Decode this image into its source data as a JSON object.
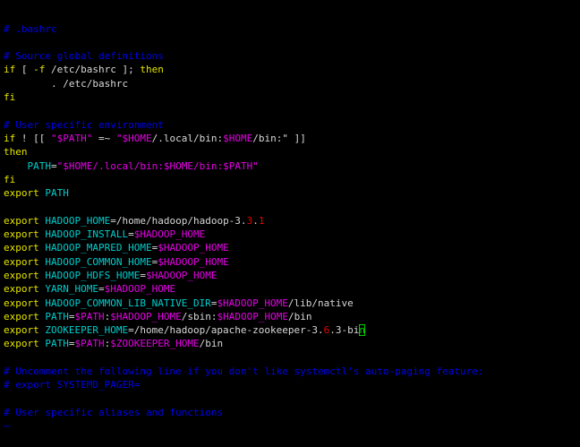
{
  "theme": {
    "background": "#000000",
    "comment": "#0000ee",
    "keyword": "#e5e500",
    "text": "#d8d8d8",
    "variable": "#e500e5",
    "number": "#e50000",
    "identifier": "#00cdcd",
    "cursor": "#00cd00"
  },
  "editor": {
    "lines": [
      [
        [
          "c-comment",
          "# .bashrc"
        ]
      ],
      [],
      [
        [
          "c-comment",
          "# Source global definitions"
        ]
      ],
      [
        [
          "c-kw",
          "if"
        ],
        [
          "c-plain",
          " [ "
        ],
        [
          "c-kw",
          "-f"
        ],
        [
          "c-plain",
          " /etc/bashrc ]; "
        ],
        [
          "c-kw",
          "then"
        ]
      ],
      [
        [
          "c-plain",
          "        . /etc/bashrc"
        ]
      ],
      [
        [
          "c-kw",
          "fi"
        ]
      ],
      [],
      [
        [
          "c-comment",
          "# User specific environment"
        ]
      ],
      [
        [
          "c-kw",
          "if"
        ],
        [
          "c-plain",
          " ! [[ "
        ],
        [
          "c-var",
          "\"$PATH\""
        ],
        [
          "c-plain",
          " =~ "
        ],
        [
          "c-var",
          "\"$HOME"
        ],
        [
          "c-plain",
          "/.local/bin:"
        ],
        [
          "c-var",
          "$HOME"
        ],
        [
          "c-plain",
          "/bin:\""
        ],
        [
          "c-plain",
          " ]]"
        ]
      ],
      [
        [
          "c-kw",
          "then"
        ]
      ],
      [
        [
          "c-plain",
          "    "
        ],
        [
          "c-ident",
          "PATH"
        ],
        [
          "c-plain",
          "="
        ],
        [
          "c-var",
          "\"$HOME"
        ],
        [
          "c-var",
          "/.local/bin:"
        ],
        [
          "c-var",
          "$HOME"
        ],
        [
          "c-var",
          "/bin:"
        ],
        [
          "c-var",
          "$PATH\""
        ]
      ],
      [
        [
          "c-kw",
          "fi"
        ]
      ],
      [
        [
          "c-kw",
          "export"
        ],
        [
          "c-plain",
          " "
        ],
        [
          "c-ident",
          "PATH"
        ]
      ],
      [],
      [
        [
          "c-kw",
          "export"
        ],
        [
          "c-plain",
          " "
        ],
        [
          "c-ident",
          "HADOOP_HOME"
        ],
        [
          "c-plain",
          "=/home/hadoop/hadoop-3."
        ],
        [
          "c-num",
          "3"
        ],
        [
          "c-plain",
          "."
        ],
        [
          "c-num",
          "1"
        ]
      ],
      [
        [
          "c-kw",
          "export"
        ],
        [
          "c-plain",
          " "
        ],
        [
          "c-ident",
          "HADOOP_INSTALL"
        ],
        [
          "c-plain",
          "="
        ],
        [
          "c-var",
          "$HADOOP_HOME"
        ]
      ],
      [
        [
          "c-kw",
          "export"
        ],
        [
          "c-plain",
          " "
        ],
        [
          "c-ident",
          "HADOOP_MAPRED_HOME"
        ],
        [
          "c-plain",
          "="
        ],
        [
          "c-var",
          "$HADOOP_HOME"
        ]
      ],
      [
        [
          "c-kw",
          "export"
        ],
        [
          "c-plain",
          " "
        ],
        [
          "c-ident",
          "HADOOP_COMMON_HOME"
        ],
        [
          "c-plain",
          "="
        ],
        [
          "c-var",
          "$HADOOP_HOME"
        ]
      ],
      [
        [
          "c-kw",
          "export"
        ],
        [
          "c-plain",
          " "
        ],
        [
          "c-ident",
          "HADOOP_HDFS_HOME"
        ],
        [
          "c-plain",
          "="
        ],
        [
          "c-var",
          "$HADOOP_HOME"
        ]
      ],
      [
        [
          "c-kw",
          "export"
        ],
        [
          "c-plain",
          " "
        ],
        [
          "c-ident",
          "YARN_HOME"
        ],
        [
          "c-plain",
          "="
        ],
        [
          "c-var",
          "$HADOOP_HOME"
        ]
      ],
      [
        [
          "c-kw",
          "export"
        ],
        [
          "c-plain",
          " "
        ],
        [
          "c-ident",
          "HADOOP_COMMON_LIB_NATIVE_DIR"
        ],
        [
          "c-plain",
          "="
        ],
        [
          "c-var",
          "$HADOOP_HOME"
        ],
        [
          "c-plain",
          "/lib/native"
        ]
      ],
      [
        [
          "c-kw",
          "export"
        ],
        [
          "c-plain",
          " "
        ],
        [
          "c-ident",
          "PATH"
        ],
        [
          "c-plain",
          "="
        ],
        [
          "c-var",
          "$PATH"
        ],
        [
          "c-plain",
          ":"
        ],
        [
          "c-var",
          "$HADOOP_HOME"
        ],
        [
          "c-plain",
          "/sbin:"
        ],
        [
          "c-var",
          "$HADOOP_HOME"
        ],
        [
          "c-plain",
          "/bin"
        ]
      ],
      [
        [
          "c-kw",
          "export"
        ],
        [
          "c-plain",
          " "
        ],
        [
          "c-ident",
          "ZOOKEEPER_HOME"
        ],
        [
          "c-plain",
          "=/home/hadoop/apache-zookeeper-3."
        ],
        [
          "c-num",
          "6"
        ],
        [
          "c-plain",
          ".3-bi"
        ],
        [
          "cursor",
          "n"
        ]
      ],
      [
        [
          "c-kw",
          "export"
        ],
        [
          "c-plain",
          " "
        ],
        [
          "c-ident",
          "PATH"
        ],
        [
          "c-plain",
          "="
        ],
        [
          "c-var",
          "$PATH"
        ],
        [
          "c-plain",
          ":"
        ],
        [
          "c-var",
          "$ZOOKEEPER_HOME"
        ],
        [
          "c-plain",
          "/bin"
        ]
      ],
      [],
      [
        [
          "c-comment",
          "# Uncomment the following line if you don't like systemctl's auto-paging feature:"
        ]
      ],
      [
        [
          "c-comment",
          "# export SYSTEMD_PAGER="
        ]
      ],
      [],
      [
        [
          "c-comment",
          "# User specific aliases and functions"
        ]
      ],
      [
        [
          "c-tilde",
          "~"
        ]
      ]
    ]
  }
}
